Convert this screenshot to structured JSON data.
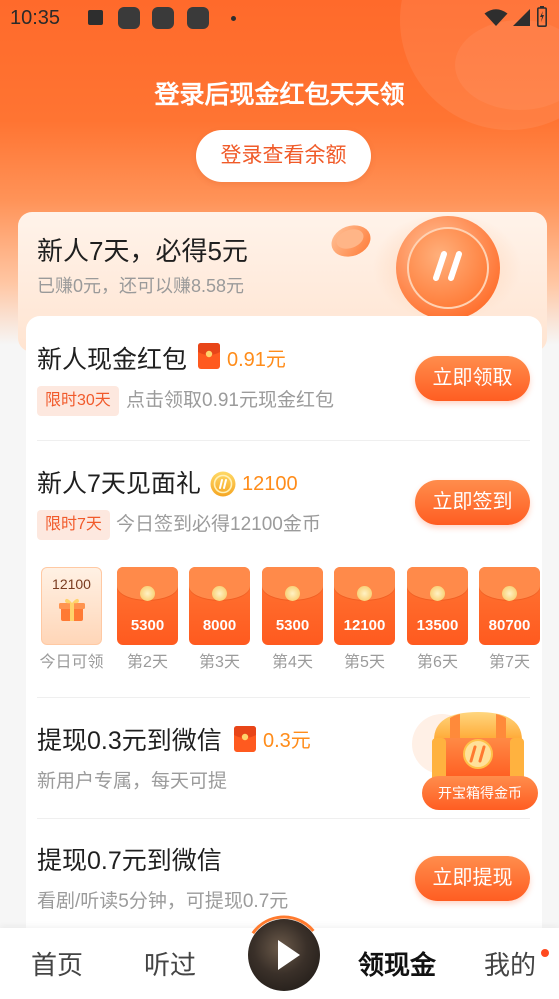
{
  "status_bar": {
    "time": "10:35",
    "icons": [
      "notification-icon",
      "app-icon",
      "app-icon",
      "app-icon",
      "dot-icon",
      "wifi-icon",
      "signal-icon",
      "battery-icon"
    ]
  },
  "header": {
    "title": "登录后现金红包天天领",
    "login_button": "登录查看余额"
  },
  "promo": {
    "title": "新人7天，必得5元",
    "subtitle": "已赚0元，还可以赚8.58元",
    "illustration": "gold-coin-icon"
  },
  "tasks": [
    {
      "title": "新人现金红包",
      "icon": "red-envelope-icon",
      "reward": "0.91元",
      "badge": "限时30天",
      "description": "点击领取0.91元现金红包",
      "button": "立即领取"
    },
    {
      "title": "新人7天见面礼",
      "icon": "coin-icon",
      "reward": "12100",
      "badge": "限时7天",
      "description": "今日签到必得12100金币",
      "button": "立即签到"
    },
    {
      "title": "提现0.3元到微信",
      "icon": "red-envelope-icon",
      "reward": "0.3元",
      "description": "新用户专属，每天可提",
      "button": "开宝箱得金币",
      "illustration": "treasure-chest-icon"
    },
    {
      "title": "提现0.7元到微信",
      "description": "看剧/听读5分钟，可提现0.7元",
      "button": "立即提现"
    }
  ],
  "checkin": {
    "days": [
      {
        "amount": "12100",
        "label": "今日可领",
        "today": true,
        "icon": "gift-icon"
      },
      {
        "amount": "5300",
        "label": "第2天",
        "today": false
      },
      {
        "amount": "8000",
        "label": "第3天",
        "today": false
      },
      {
        "amount": "5300",
        "label": "第4天",
        "today": false
      },
      {
        "amount": "12100",
        "label": "第5天",
        "today": false
      },
      {
        "amount": "13500",
        "label": "第6天",
        "today": false
      },
      {
        "amount": "80700",
        "label": "第7天",
        "today": false
      }
    ]
  },
  "bottom_nav": {
    "items": [
      {
        "label": "首页",
        "active": false,
        "has_dot": false
      },
      {
        "label": "听过",
        "active": false,
        "has_dot": false
      },
      {
        "label": "领现金",
        "active": true,
        "has_dot": false
      },
      {
        "label": "我的",
        "active": false,
        "has_dot": true
      }
    ],
    "center_button": "play-icon"
  },
  "colors": {
    "brand_orange": "#ff6a2b",
    "button_orange": "#ff5d22",
    "reward_orange": "#ff8c1a",
    "badge_bg": "#fde8df",
    "badge_text": "#f15a2b",
    "notification_dot": "#ff4a1f"
  }
}
